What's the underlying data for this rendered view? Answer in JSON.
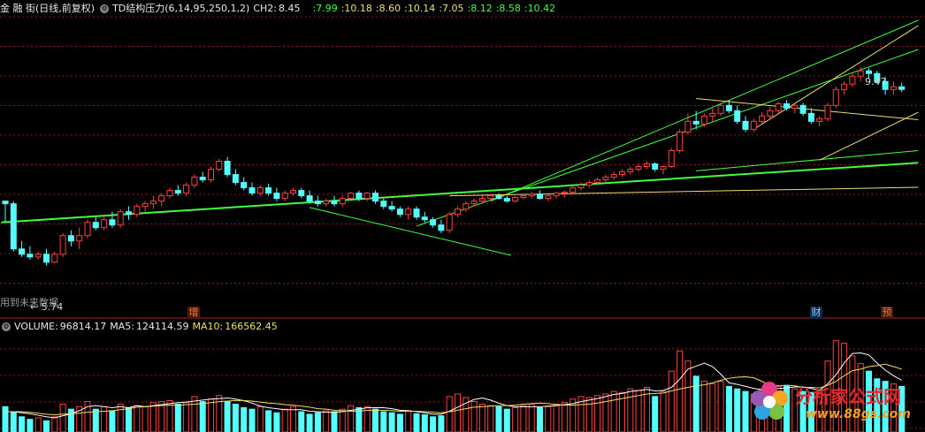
{
  "top_header": {
    "title": "金 融 街(日线,前复权)",
    "indicator_name": "TD结构压力(6,14,95,250,1,2)",
    "ch2_label": "CH2:",
    "ch2_value": "8.45",
    "values": [
      ":7.99",
      ":10.18",
      ":8.60",
      ":10.14",
      ":7.05",
      ":8.12",
      ":8.58",
      ":10.42"
    ]
  },
  "volume_header": {
    "volume_label": "VOLUME:",
    "volume_value": "96814.17",
    "ma5_label": "MA5:",
    "ma5_value": "124114.59",
    "ma10_label": "MA10:",
    "ma10_value": "166562.45"
  },
  "annotations": {
    "high_label": "9.47",
    "low_label": "← 5.74",
    "future_note": "用到未来数据"
  },
  "markers": [
    "增",
    "财",
    "预"
  ],
  "watermark": {
    "title": "分析家公式网",
    "url": "www.88gs.com"
  },
  "colors": {
    "up": "#ff4040",
    "down": "#54ffff",
    "ma5": "#ffffff",
    "ma10": "#f0e060",
    "trend_green": "#40ff40",
    "trend_yellow": "#e8e070",
    "grid": "#8b1a1a"
  },
  "chart_data": [
    {
      "type": "candlestick",
      "title": "金融街(日线,前复权)",
      "high": 9.47,
      "low": 5.74,
      "ohlc": [
        [
          6.95,
          6.95,
          6.55,
          6.9
        ],
        [
          6.9,
          6.95,
          6.0,
          6.05
        ],
        [
          6.05,
          6.2,
          5.9,
          5.95
        ],
        [
          5.95,
          6.1,
          5.85,
          5.9
        ],
        [
          5.9,
          6.0,
          5.85,
          5.95
        ],
        [
          5.95,
          6.05,
          5.74,
          5.8
        ],
        [
          5.8,
          6.0,
          5.78,
          5.95
        ],
        [
          5.95,
          6.35,
          5.9,
          6.3
        ],
        [
          6.3,
          6.4,
          6.1,
          6.2
        ],
        [
          6.2,
          6.45,
          6.05,
          6.3
        ],
        [
          6.3,
          6.6,
          6.25,
          6.55
        ],
        [
          6.55,
          6.65,
          6.4,
          6.45
        ],
        [
          6.45,
          6.7,
          6.4,
          6.6
        ],
        [
          6.6,
          6.75,
          6.45,
          6.5
        ],
        [
          6.5,
          6.8,
          6.45,
          6.75
        ],
        [
          6.75,
          6.85,
          6.6,
          6.7
        ],
        [
          6.7,
          6.9,
          6.65,
          6.85
        ],
        [
          6.85,
          6.95,
          6.75,
          6.9
        ],
        [
          6.9,
          7.05,
          6.8,
          6.95
        ],
        [
          6.95,
          7.1,
          6.85,
          7.05
        ],
        [
          7.05,
          7.2,
          7.0,
          7.15
        ],
        [
          7.15,
          7.25,
          7.05,
          7.1
        ],
        [
          7.1,
          7.3,
          7.05,
          7.25
        ],
        [
          7.25,
          7.45,
          7.2,
          7.4
        ],
        [
          7.4,
          7.5,
          7.3,
          7.35
        ],
        [
          7.35,
          7.6,
          7.3,
          7.55
        ],
        [
          7.55,
          7.75,
          7.5,
          7.7
        ],
        [
          7.7,
          7.78,
          7.4,
          7.45
        ],
        [
          7.45,
          7.55,
          7.25,
          7.3
        ],
        [
          7.3,
          7.4,
          7.15,
          7.2
        ],
        [
          7.2,
          7.3,
          7.05,
          7.1
        ],
        [
          7.1,
          7.25,
          7.05,
          7.2
        ],
        [
          7.2,
          7.28,
          7.05,
          7.1
        ],
        [
          7.1,
          7.2,
          6.95,
          7.0
        ],
        [
          7.0,
          7.15,
          6.95,
          7.1
        ],
        [
          7.1,
          7.2,
          7.05,
          7.15
        ],
        [
          7.15,
          7.2,
          7.0,
          7.05
        ],
        [
          7.05,
          7.15,
          6.9,
          6.95
        ],
        [
          6.95,
          7.05,
          6.85,
          6.9
        ],
        [
          6.9,
          7.0,
          6.85,
          6.95
        ],
        [
          6.95,
          7.05,
          6.85,
          6.9
        ],
        [
          6.9,
          7.05,
          6.85,
          7.0
        ],
        [
          7.0,
          7.12,
          6.98,
          7.1
        ],
        [
          7.1,
          7.15,
          6.95,
          7.0
        ],
        [
          7.0,
          7.12,
          6.95,
          7.1
        ],
        [
          7.1,
          7.15,
          6.9,
          6.95
        ],
        [
          6.95,
          7.0,
          6.8,
          6.85
        ],
        [
          6.85,
          6.95,
          6.75,
          6.8
        ],
        [
          6.8,
          6.85,
          6.65,
          6.7
        ],
        [
          6.7,
          6.85,
          6.6,
          6.8
        ],
        [
          6.8,
          6.85,
          6.6,
          6.65
        ],
        [
          6.65,
          6.75,
          6.55,
          6.6
        ],
        [
          6.6,
          6.65,
          6.45,
          6.5
        ],
        [
          6.5,
          6.6,
          6.35,
          6.4
        ],
        [
          6.4,
          6.75,
          6.35,
          6.7
        ],
        [
          6.7,
          6.85,
          6.65,
          6.8
        ],
        [
          6.8,
          6.95,
          6.75,
          6.9
        ],
        [
          6.9,
          7.0,
          6.85,
          6.95
        ],
        [
          6.95,
          7.05,
          6.9,
          7.0
        ],
        [
          7.0,
          7.08,
          6.95,
          7.05
        ],
        [
          7.05,
          7.1,
          6.98,
          7.0
        ],
        [
          7.0,
          7.05,
          6.92,
          6.95
        ],
        [
          6.95,
          7.05,
          6.92,
          7.02
        ],
        [
          7.02,
          7.1,
          6.98,
          7.05
        ],
        [
          7.05,
          7.12,
          7.0,
          7.08
        ],
        [
          7.08,
          7.15,
          6.98,
          7.0
        ],
        [
          7.0,
          7.08,
          6.95,
          7.05
        ],
        [
          7.05,
          7.12,
          7.0,
          7.1
        ],
        [
          7.1,
          7.15,
          7.02,
          7.12
        ],
        [
          7.12,
          7.25,
          7.1,
          7.2
        ],
        [
          7.2,
          7.3,
          7.15,
          7.25
        ],
        [
          7.25,
          7.35,
          7.2,
          7.3
        ],
        [
          7.3,
          7.4,
          7.25,
          7.35
        ],
        [
          7.35,
          7.45,
          7.3,
          7.4
        ],
        [
          7.4,
          7.5,
          7.35,
          7.45
        ],
        [
          7.45,
          7.55,
          7.4,
          7.5
        ],
        [
          7.5,
          7.6,
          7.45,
          7.55
        ],
        [
          7.55,
          7.65,
          7.5,
          7.6
        ],
        [
          7.6,
          7.7,
          7.55,
          7.65
        ],
        [
          7.65,
          7.68,
          7.5,
          7.55
        ],
        [
          7.55,
          7.62,
          7.45,
          7.6
        ],
        [
          7.6,
          7.95,
          7.58,
          7.9
        ],
        [
          7.9,
          8.3,
          7.85,
          8.25
        ],
        [
          8.25,
          8.6,
          8.2,
          8.45
        ],
        [
          8.45,
          8.65,
          8.3,
          8.4
        ],
        [
          8.4,
          8.6,
          8.35,
          8.55
        ],
        [
          8.55,
          8.7,
          8.45,
          8.6
        ],
        [
          8.6,
          8.8,
          8.55,
          8.75
        ],
        [
          8.75,
          8.85,
          8.6,
          8.65
        ],
        [
          8.65,
          8.75,
          8.4,
          8.45
        ],
        [
          8.45,
          8.55,
          8.25,
          8.3
        ],
        [
          8.3,
          8.5,
          8.25,
          8.45
        ],
        [
          8.45,
          8.62,
          8.4,
          8.55
        ],
        [
          8.55,
          8.72,
          8.5,
          8.65
        ],
        [
          8.65,
          8.82,
          8.6,
          8.78
        ],
        [
          8.78,
          8.85,
          8.65,
          8.7
        ],
        [
          8.7,
          8.8,
          8.6,
          8.75
        ],
        [
          8.75,
          8.8,
          8.55,
          8.6
        ],
        [
          8.6,
          8.7,
          8.4,
          8.45
        ],
        [
          8.45,
          8.55,
          8.35,
          8.5
        ],
        [
          8.5,
          8.8,
          8.45,
          8.75
        ],
        [
          8.75,
          9.1,
          8.7,
          9.05
        ],
        [
          9.05,
          9.2,
          8.95,
          9.15
        ],
        [
          9.15,
          9.35,
          9.1,
          9.3
        ],
        [
          9.3,
          9.47,
          9.2,
          9.4
        ],
        [
          9.4,
          9.45,
          9.25,
          9.35
        ],
        [
          9.35,
          9.4,
          9.15,
          9.2
        ],
        [
          9.2,
          9.28,
          8.95,
          9.05
        ],
        [
          9.05,
          9.2,
          8.95,
          9.1
        ],
        [
          9.1,
          9.18,
          9.0,
          9.05
        ]
      ]
    },
    {
      "type": "bar",
      "title": "VOLUME",
      "values": [
        50,
        40,
        30,
        25,
        28,
        22,
        30,
        55,
        45,
        50,
        60,
        45,
        50,
        42,
        55,
        48,
        52,
        50,
        58,
        60,
        62,
        55,
        58,
        70,
        60,
        65,
        72,
        60,
        55,
        48,
        45,
        50,
        42,
        38,
        45,
        50,
        40,
        35,
        38,
        42,
        40,
        45,
        52,
        48,
        50,
        45,
        40,
        38,
        35,
        42,
        36,
        34,
        30,
        32,
        70,
        75,
        68,
        60,
        55,
        52,
        50,
        45,
        48,
        52,
        55,
        48,
        50,
        55,
        58,
        65,
        70,
        68,
        72,
        75,
        80,
        78,
        85,
        82,
        88,
        70,
        80,
        120,
        160,
        140,
        110,
        100,
        95,
        100,
        90,
        85,
        80,
        75,
        85,
        95,
        90,
        92,
        85,
        80,
        78,
        75,
        140,
        180,
        175,
        150,
        135,
        120,
        105,
        100,
        95,
        90
      ],
      "ma5": [
        40,
        40,
        38,
        36,
        33,
        30,
        28,
        32,
        36,
        42,
        50,
        52,
        50,
        48,
        50,
        48,
        52,
        50,
        52,
        54,
        56,
        58,
        59,
        61,
        63,
        65,
        66,
        67,
        65,
        62,
        57,
        51,
        48,
        46,
        44,
        44,
        44,
        41,
        40,
        39,
        39,
        40,
        43,
        45,
        48,
        48,
        48,
        46,
        43,
        42,
        40,
        38,
        35,
        35,
        41,
        49,
        57,
        64,
        67,
        63,
        57,
        52,
        50,
        50,
        50,
        50,
        51,
        52,
        54,
        56,
        60,
        63,
        66,
        70,
        74,
        76,
        80,
        82,
        84,
        81,
        82,
        88,
        104,
        124,
        130,
        136,
        129,
        114,
        97,
        94,
        90,
        86,
        83,
        84,
        86,
        87,
        89,
        89,
        86,
        82,
        95,
        113,
        136,
        155,
        156,
        152,
        136,
        122,
        111,
        102
      ],
      "ma10": [
        40,
        40,
        40,
        39,
        37,
        35,
        34,
        35,
        36,
        37,
        39,
        40,
        41,
        42,
        44,
        46,
        49,
        50,
        51,
        52,
        53,
        53,
        54,
        55,
        56,
        58,
        60,
        61,
        62,
        62,
        61,
        59,
        57,
        56,
        54,
        53,
        51,
        49,
        46,
        45,
        43,
        42,
        41,
        41,
        43,
        43,
        43,
        42,
        41,
        41,
        41,
        40,
        39,
        38,
        40,
        43,
        46,
        49,
        50,
        51,
        52,
        52,
        53,
        55,
        56,
        57,
        56,
        54,
        53,
        53,
        54,
        55,
        57,
        60,
        63,
        66,
        69,
        72,
        75,
        76,
        77,
        81,
        85,
        88,
        91,
        93,
        97,
        102,
        106,
        108,
        109,
        107,
        100,
        92,
        91,
        92,
        91,
        88,
        88,
        87,
        92,
        100,
        111,
        121,
        124,
        129,
        131,
        134,
        129,
        124
      ]
    }
  ]
}
